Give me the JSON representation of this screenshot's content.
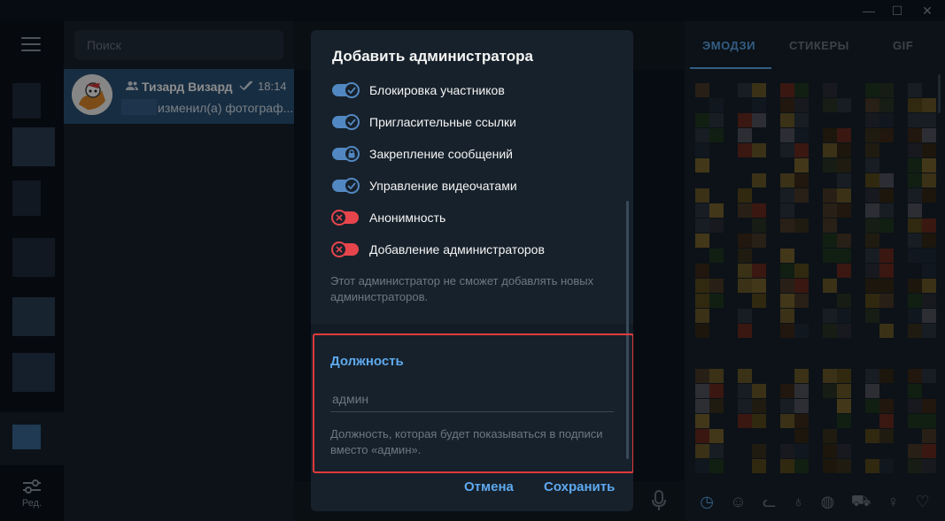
{
  "window": {
    "controls": {
      "minimize": "—",
      "maximize": "☐",
      "close": "✕"
    }
  },
  "sidebar": {
    "edit_label": "Ред."
  },
  "chatlist": {
    "search_placeholder": "Поиск",
    "chats": [
      {
        "name": "Тизард Визард",
        "time": "18:14",
        "message": "изменил(а) фотограф..."
      }
    ]
  },
  "emoji_panel": {
    "tabs": [
      "ЭМОДЗИ",
      "СТИКЕРЫ",
      "GIF"
    ],
    "active_tab": "ЭМОДЗИ",
    "categories": [
      "clock-icon",
      "smile-icon",
      "cat-icon",
      "apple-icon",
      "ball-icon",
      "car-icon",
      "bulb-icon",
      "heart-icon"
    ]
  },
  "dialog": {
    "title": "Добавить администратора",
    "permissions": [
      {
        "label": "Блокировка участников",
        "state": "on"
      },
      {
        "label": "Пригласительные ссылки",
        "state": "on"
      },
      {
        "label": "Закрепление сообщений",
        "state": "locked"
      },
      {
        "label": "Управление видеочатами",
        "state": "on"
      },
      {
        "label": "Анонимность",
        "state": "off"
      },
      {
        "label": "Добавление администраторов",
        "state": "off"
      }
    ],
    "note": "Этот администратор не сможет добавлять новых администраторов.",
    "rank_section": {
      "heading": "Должность",
      "placeholder": "админ",
      "hint": "Должность, которая будет показываться в подписи вместо «админ»."
    },
    "buttons": {
      "cancel": "Отмена",
      "save": "Сохранить"
    }
  },
  "colors": {
    "accent": "#5ea9ee",
    "toggle_on": "#5288c1",
    "toggle_off": "#e6454c",
    "highlight": "#e13a3a",
    "dialog_bg": "#17212b"
  }
}
